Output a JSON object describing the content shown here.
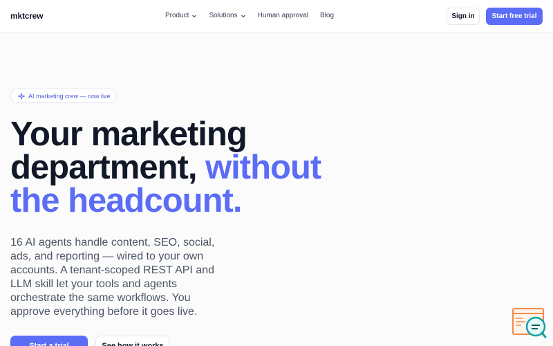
{
  "brand": {
    "name": "mktcrew"
  },
  "nav": {
    "links": [
      {
        "label": "Product",
        "has_dropdown": true
      },
      {
        "label": "Solutions",
        "has_dropdown": true
      },
      {
        "label": "Human approval",
        "has_dropdown": false
      },
      {
        "label": "Blog",
        "has_dropdown": false
      }
    ],
    "sign_in": "Sign in",
    "start_trial": "Start free trial"
  },
  "hero": {
    "badge": {
      "icon": "sparkle-icon",
      "label": "AI marketing crew — now live"
    },
    "headline_line1": "Your marketing",
    "headline_line2": "department,",
    "headline_accent_line2": "without",
    "headline_accent_line3": "the headcount.",
    "subtext": "16 AI agents handle content, SEO, social, ads, and reporting — wired to your own accounts. A tenant-scoped REST API and LLM skill let your tools and agents orchestrate the same workflows. You approve everything before it goes live.",
    "primary_cta": "Start a trial",
    "secondary_cta": "See how it works"
  },
  "colors": {
    "accent": "#5b6cf5",
    "text": "#111827",
    "muted": "#4b5563",
    "widget_orange": "#f08a4b",
    "widget_teal": "#16a3a6"
  }
}
